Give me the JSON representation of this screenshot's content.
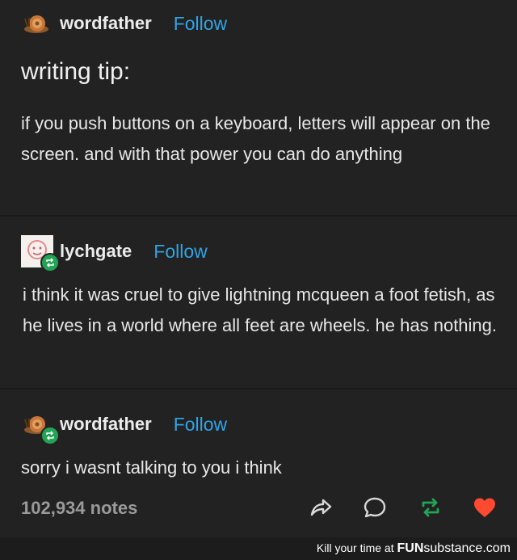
{
  "posts": [
    {
      "username": "wordfather",
      "follow_label": "Follow",
      "heading": "writing tip:",
      "body": "if you push buttons on a keyboard, letters will appear on the screen. and with that power you can do anything"
    },
    {
      "username": "lychgate",
      "follow_label": "Follow",
      "body": "i think it was cruel to give lightning mcqueen a foot fetish, as he lives in a world where all feet are wheels. he has nothing."
    },
    {
      "username": "wordfather",
      "follow_label": "Follow",
      "body": "sorry i wasnt talking to you i think"
    }
  ],
  "footer": {
    "notes": "102,934 notes",
    "icons": [
      "share-icon",
      "reply-icon",
      "reblog-icon",
      "like-icon"
    ]
  },
  "watermark": {
    "prefix": "Kill your time at ",
    "brand_fun": "FUN",
    "brand_rest": "substance.com"
  },
  "colors": {
    "background": "#222222",
    "follow": "#2fa4e7",
    "reblog": "#23a455",
    "like": "#ff4930"
  }
}
